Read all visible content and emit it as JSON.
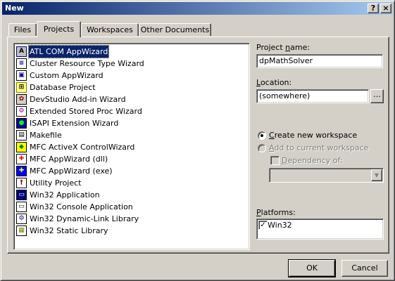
{
  "window": {
    "title": "New",
    "help_button": "?",
    "close_button": "×"
  },
  "tabs": [
    {
      "label": "Files"
    },
    {
      "label": "Projects"
    },
    {
      "label": "Workspaces"
    },
    {
      "label": "Other Documents"
    }
  ],
  "project_types": [
    {
      "label": "ATL COM AppWizard",
      "icon": "atl-com-appwizard-icon",
      "selected": true
    },
    {
      "label": "Cluster Resource Type Wizard",
      "icon": "cluster-resource-icon"
    },
    {
      "label": "Custom AppWizard",
      "icon": "custom-appwizard-icon"
    },
    {
      "label": "Database Project",
      "icon": "database-project-icon"
    },
    {
      "label": "DevStudio Add-in Wizard",
      "icon": "devstudio-addin-icon"
    },
    {
      "label": "Extended Stored Proc Wizard",
      "icon": "extended-stored-proc-icon"
    },
    {
      "label": "ISAPI Extension Wizard",
      "icon": "isapi-extension-icon"
    },
    {
      "label": "Makefile",
      "icon": "makefile-icon"
    },
    {
      "label": "MFC ActiveX ControlWizard",
      "icon": "mfc-activex-icon"
    },
    {
      "label": "MFC AppWizard (dll)",
      "icon": "mfc-appwizard-dll-icon"
    },
    {
      "label": "MFC AppWizard (exe)",
      "icon": "mfc-appwizard-exe-icon"
    },
    {
      "label": "Utility Project",
      "icon": "utility-project-icon"
    },
    {
      "label": "Win32 Application",
      "icon": "win32-application-icon"
    },
    {
      "label": "Win32 Console Application",
      "icon": "win32-console-icon"
    },
    {
      "label": "Win32 Dynamic-Link Library",
      "icon": "win32-dll-icon"
    },
    {
      "label": "Win32 Static Library",
      "icon": "win32-static-lib-icon"
    }
  ],
  "project_name": {
    "label_pre": "Project ",
    "label_accel": "n",
    "label_post": "ame:",
    "value": "dpMathSolver"
  },
  "location": {
    "label_accel": "L",
    "label_post": "ocation:",
    "value": "(somewhere)",
    "browse_label": "..."
  },
  "workspace": {
    "create_new_accel": "C",
    "create_new_post": "reate new workspace",
    "create_new_selected": true,
    "add_current_accel": "A",
    "add_current_post": "dd to current workspace",
    "dependency_accel": "D",
    "dependency_post": "ependency of:",
    "dependency_value": "",
    "dropdown_arrow": "▼"
  },
  "platforms": {
    "label_accel": "P",
    "label_post": "latforms:",
    "items": [
      {
        "label": "Win32",
        "checked": true
      }
    ]
  },
  "buttons": {
    "ok": "OK",
    "cancel": "Cancel"
  },
  "glyphs": {
    "check": "✓"
  }
}
